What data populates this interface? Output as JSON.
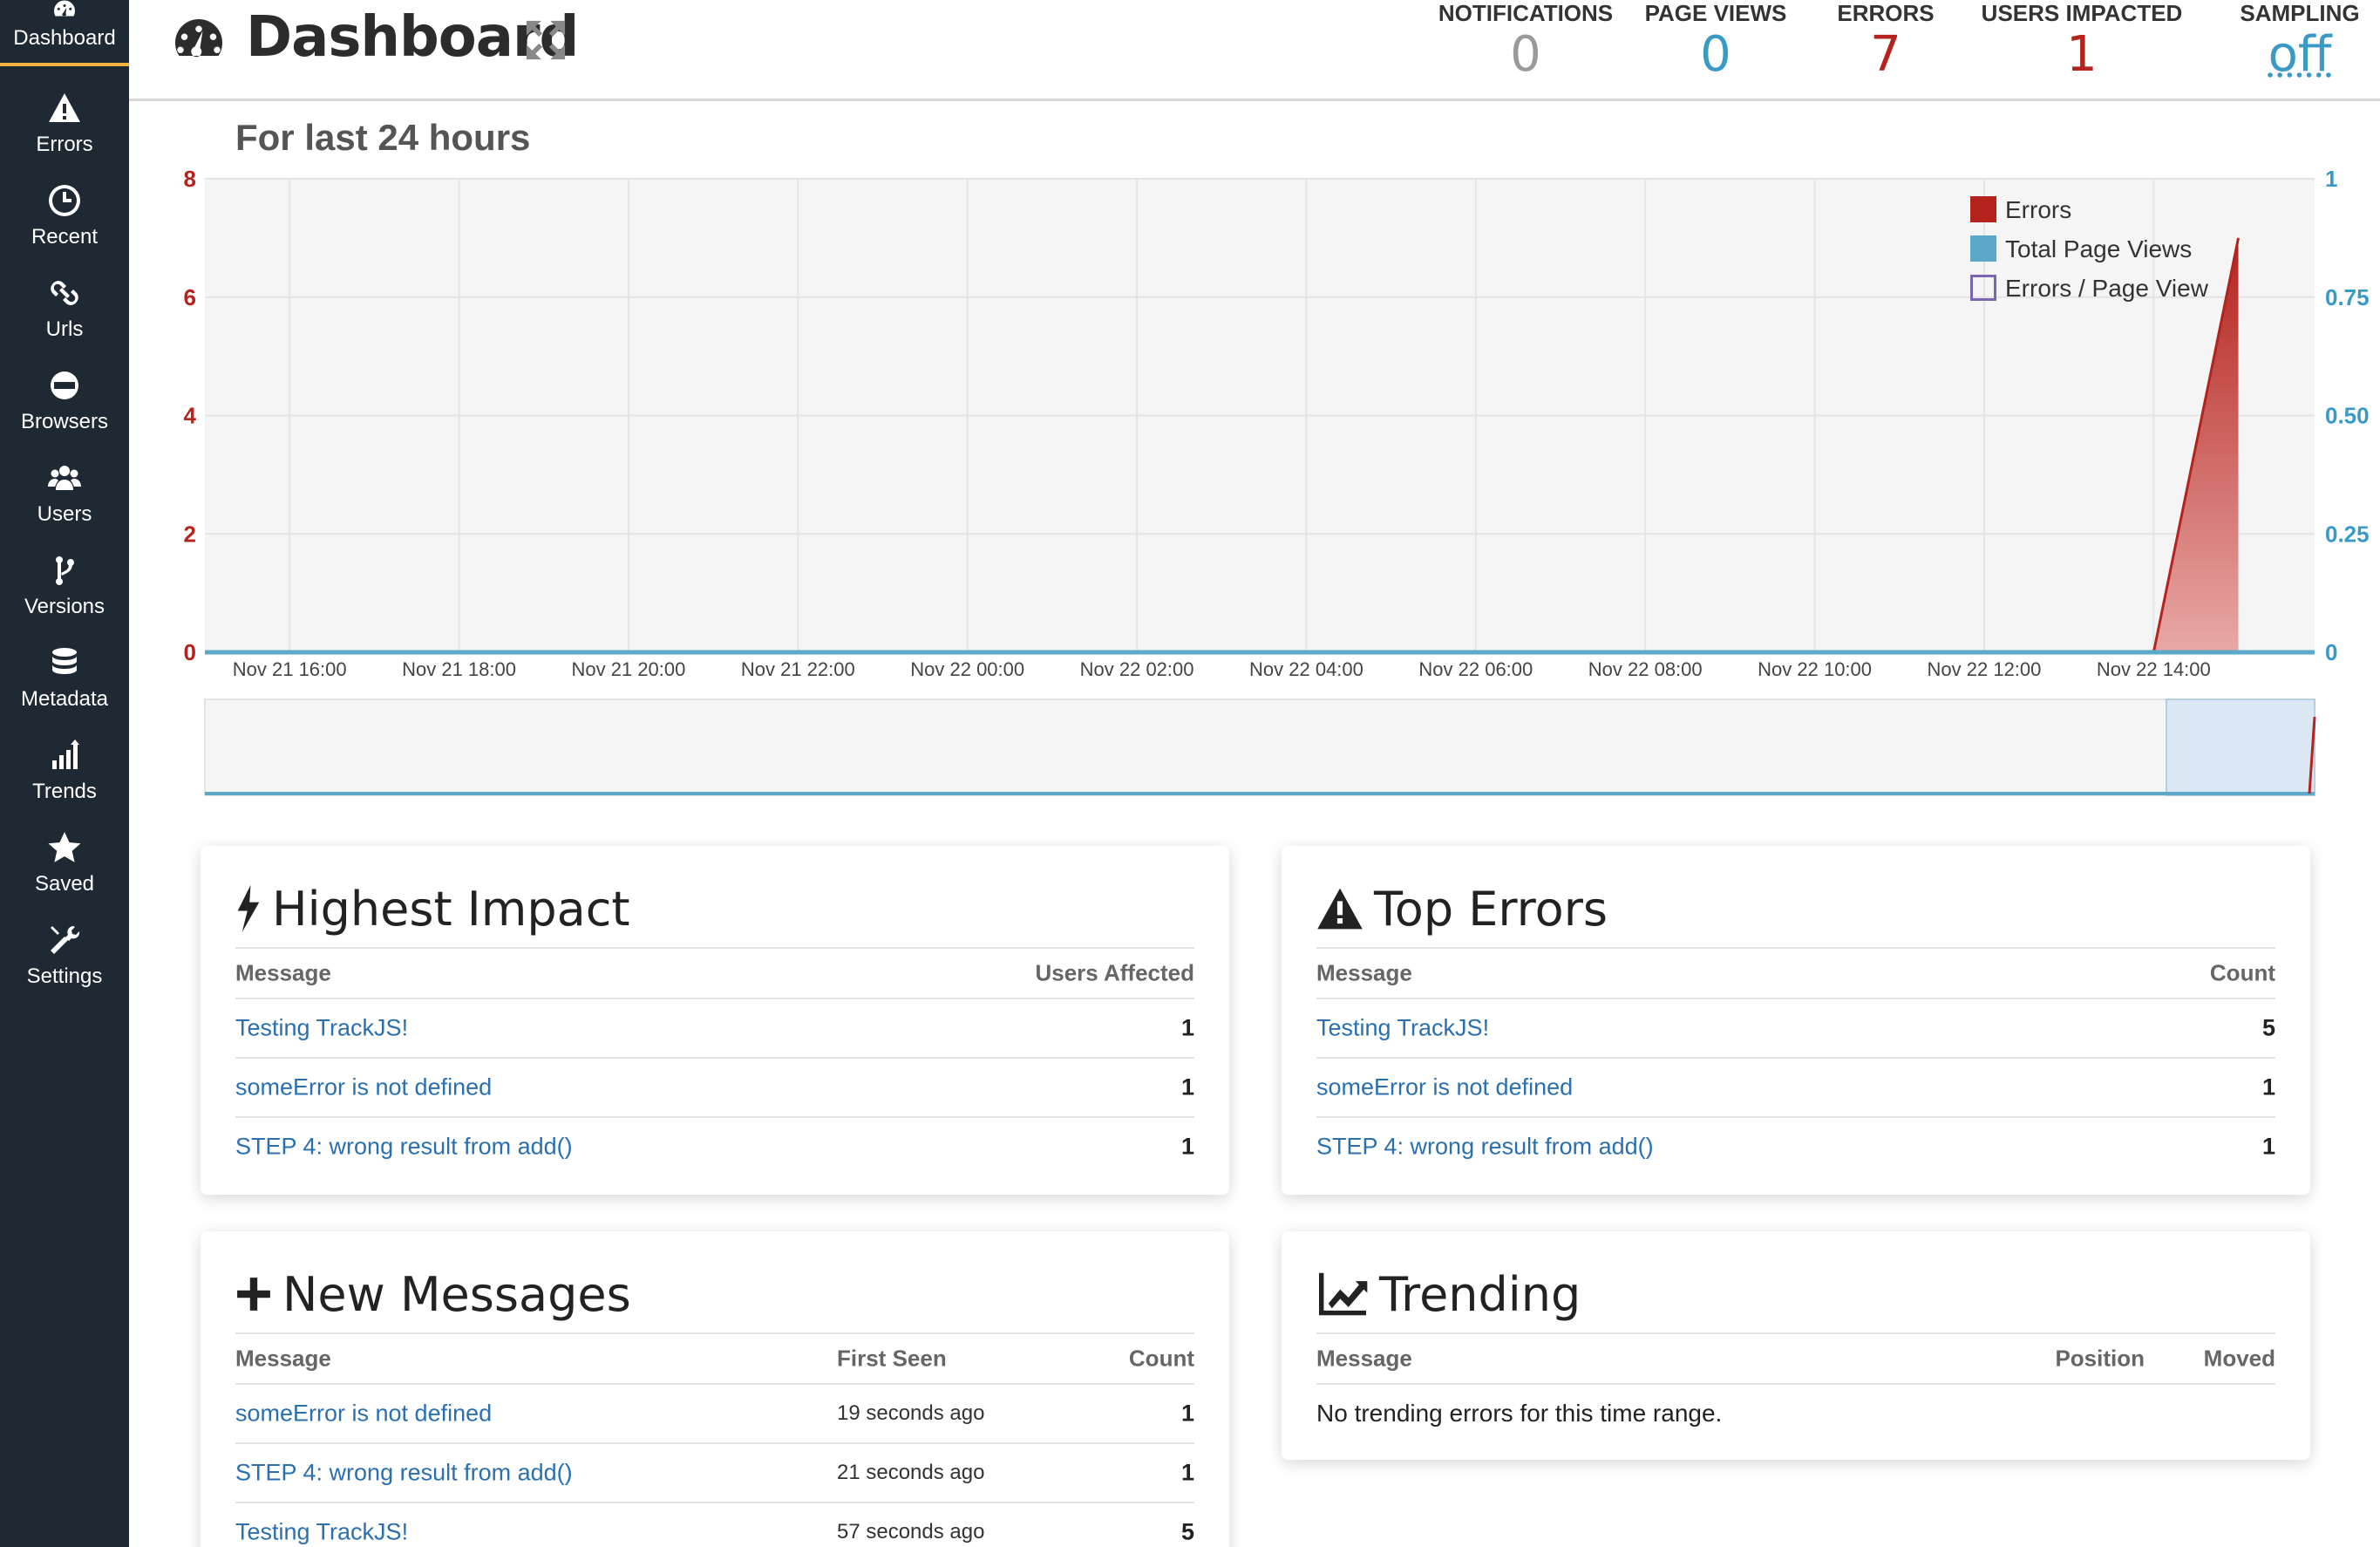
{
  "sidebar": {
    "items": [
      {
        "label": "Dashboard",
        "icon": "dashboard-icon"
      },
      {
        "label": "Errors",
        "icon": "warning-icon"
      },
      {
        "label": "Recent",
        "icon": "clock-icon"
      },
      {
        "label": "Urls",
        "icon": "link-icon"
      },
      {
        "label": "Browsers",
        "icon": "www-globe-icon"
      },
      {
        "label": "Users",
        "icon": "users-icon"
      },
      {
        "label": "Versions",
        "icon": "branch-icon"
      },
      {
        "label": "Metadata",
        "icon": "database-icon"
      },
      {
        "label": "Trends",
        "icon": "bar-trend-icon"
      },
      {
        "label": "Saved",
        "icon": "star-icon"
      },
      {
        "label": "Settings",
        "icon": "tools-icon"
      }
    ],
    "active": "Dashboard"
  },
  "header": {
    "title": "Dashboard",
    "stats": [
      {
        "label": "NOTIFICATIONS",
        "value": "0",
        "color": "#9a9a9a"
      },
      {
        "label": "PAGE VIEWS",
        "value": "0",
        "color": "#3a9ac6"
      },
      {
        "label": "ERRORS",
        "value": "7",
        "color": "#b4231d"
      },
      {
        "label": "USERS IMPACTED",
        "value": "1",
        "color": "#b4231d"
      },
      {
        "label": "SAMPLING",
        "value": "off",
        "color": "#3a9ac6"
      }
    ]
  },
  "subtitle": "For last 24 hours",
  "chart_data": {
    "type": "area",
    "x_labels": [
      "Nov 21 16:00",
      "Nov 21 18:00",
      "Nov 21 20:00",
      "Nov 21 22:00",
      "Nov 22 00:00",
      "Nov 22 02:00",
      "Nov 22 04:00",
      "Nov 22 06:00",
      "Nov 22 08:00",
      "Nov 22 10:00",
      "Nov 22 12:00",
      "Nov 22 14:00"
    ],
    "y_left": {
      "ticks": [
        "8",
        "6",
        "4",
        "2",
        "0"
      ],
      "range": [
        0,
        8
      ],
      "color": "#b4231d"
    },
    "y_right": {
      "ticks": [
        "1",
        "0.75",
        "0.50",
        "0.25",
        "0"
      ],
      "range": [
        0,
        1
      ],
      "color": "#3a9ac6"
    },
    "x_range_hours": [
      -1,
      23.9
    ],
    "series": [
      {
        "name": "Errors",
        "color": "#b4231d",
        "points": [
          [
            22.0,
            0
          ],
          [
            23.0,
            7
          ]
        ]
      },
      {
        "name": "Total Page Views",
        "color": "#5ba8c8",
        "points": [
          [
            -1,
            0
          ],
          [
            23.9,
            0
          ]
        ]
      },
      {
        "name": "Errors / Page View",
        "color": "#7a66b3",
        "points": []
      }
    ],
    "legend": [
      "Errors",
      "Total Page Views",
      "Errors / Page View"
    ],
    "legend_position": "top-right",
    "grid": true
  },
  "panels": {
    "highest_impact": {
      "title": "Highest Impact",
      "columns": [
        "Message",
        "Users Affected"
      ],
      "rows": [
        {
          "message": "Testing TrackJS!",
          "value": "1"
        },
        {
          "message": "someError is not defined",
          "value": "1"
        },
        {
          "message": "STEP 4: wrong result from add()",
          "value": "1"
        }
      ]
    },
    "top_errors": {
      "title": "Top Errors",
      "columns": [
        "Message",
        "Count"
      ],
      "rows": [
        {
          "message": "Testing TrackJS!",
          "value": "5"
        },
        {
          "message": "someError is not defined",
          "value": "1"
        },
        {
          "message": "STEP 4: wrong result from add()",
          "value": "1"
        }
      ]
    },
    "new_messages": {
      "title": "New Messages",
      "columns": [
        "Message",
        "First Seen",
        "Count"
      ],
      "rows": [
        {
          "message": "someError is not defined",
          "seen": "19 seconds ago",
          "value": "1"
        },
        {
          "message": "STEP 4: wrong result from add()",
          "seen": "21 seconds ago",
          "value": "1"
        },
        {
          "message": "Testing TrackJS!",
          "seen": "57 seconds ago",
          "value": "5"
        }
      ]
    },
    "trending": {
      "title": "Trending",
      "columns": [
        "Message",
        "Position",
        "Moved"
      ],
      "empty": "No trending errors for this time range."
    }
  }
}
